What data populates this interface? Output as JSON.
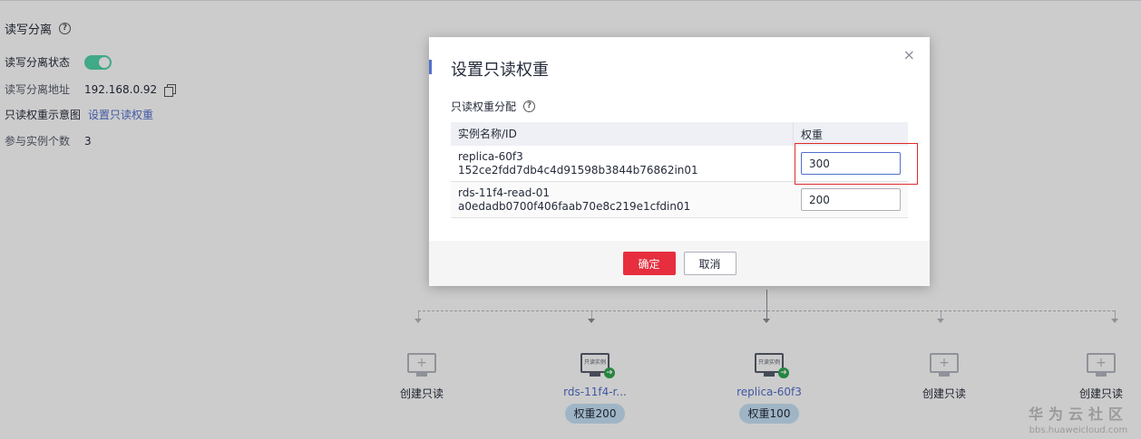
{
  "section": {
    "title": "读写分离"
  },
  "info": {
    "status_label": "读写分离状态",
    "address_label": "读写分离地址",
    "address_value": "192.168.0.92",
    "diagram_label": "只读权重示意图",
    "set_weight_link": "设置只读权重",
    "count_label": "参与实例个数",
    "count_value": "3",
    "toggle_on": true
  },
  "topology": {
    "nodes": [
      {
        "label": "创建只读",
        "kind": "create"
      },
      {
        "label": "rds-11f4-r...",
        "kind": "replica",
        "weight": "权重200",
        "screen_text": "只读实例"
      },
      {
        "label": "replica-60f3",
        "kind": "replica",
        "weight": "权重100",
        "screen_text": "只读实例"
      },
      {
        "label": "创建只读",
        "kind": "create"
      },
      {
        "label": "创建只读",
        "kind": "create"
      }
    ]
  },
  "watermark": {
    "title": "华为云社区",
    "url": "bbs.huaweicloud.com"
  },
  "modal": {
    "title": "设置只读权重",
    "subtitle": "只读权重分配",
    "close": "×",
    "columns": [
      "实例名称/ID",
      "权重"
    ],
    "rows": [
      {
        "name": "replica-60f3",
        "id": "152ce2fdd7db4c4d91598b3844b76862in01",
        "weight": "300"
      },
      {
        "name": "rds-11f4-read-01",
        "id": "a0edadb0700f406faab70e8c219e1cfdin01",
        "weight": "200"
      }
    ],
    "ok_label": "确定",
    "cancel_label": "取消"
  },
  "colors": {
    "accent": "#526ecc",
    "danger": "#e62e3e",
    "toggle": "#50d4ab",
    "highlight": "#e02b2b"
  },
  "icons": [
    "help-icon",
    "copy-icon",
    "monitor-icon",
    "close-icon"
  ]
}
